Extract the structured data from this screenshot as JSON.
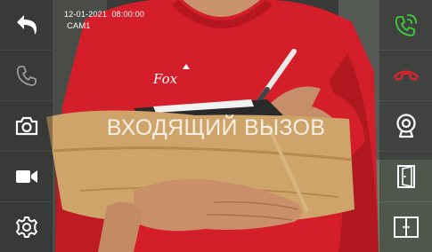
{
  "header": {
    "date": "12-01-2021",
    "time": "08:00:00",
    "camera": "CAM1"
  },
  "status": {
    "text": "ВХОДЯЩИЙ ВЫЗОВ"
  },
  "feed": {
    "logo": "Fox"
  },
  "left_controls": [
    {
      "icon": "back-icon"
    },
    {
      "icon": "phone-icon",
      "state": "disabled"
    },
    {
      "icon": "camera-icon"
    },
    {
      "icon": "video-icon"
    },
    {
      "icon": "gear-icon"
    }
  ],
  "right_controls": [
    {
      "icon": "answer-call-icon",
      "color": "#3ec23e"
    },
    {
      "icon": "hang-up-icon",
      "color": "#e0242c"
    },
    {
      "icon": "webcam-icon"
    },
    {
      "icon": "door-open-icon"
    },
    {
      "icon": "gate-open-icon"
    }
  ],
  "colors": {
    "shirt": "#d41f2a",
    "accept": "#3ec23e",
    "decline": "#e0242c"
  }
}
